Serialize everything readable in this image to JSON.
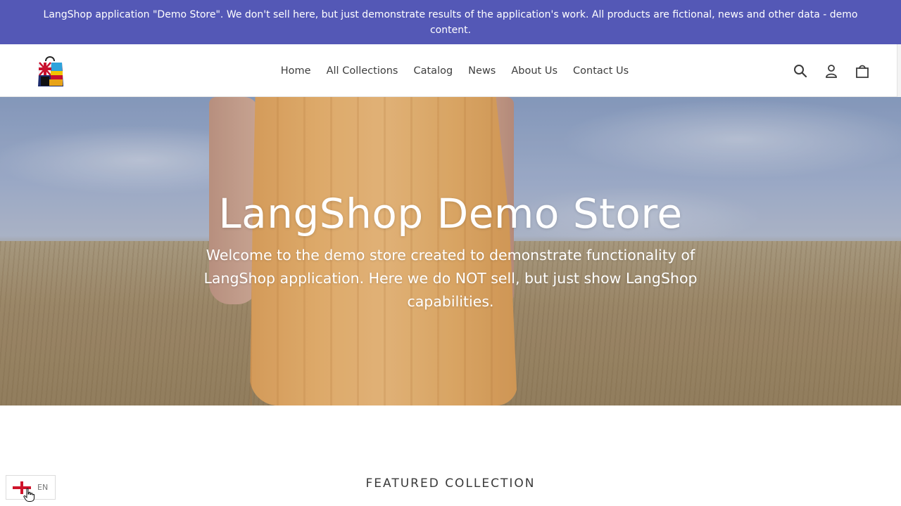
{
  "announcement": {
    "text": "LangShop application \"Demo Store\". We don't sell here, but just demonstrate results of the application's work. All products are fictional, news and other data - demo content."
  },
  "header": {
    "logo_icon": "shopping-bag-flags-logo",
    "nav": [
      {
        "label": "Home"
      },
      {
        "label": "All Collections"
      },
      {
        "label": "Catalog"
      },
      {
        "label": "News"
      },
      {
        "label": "About Us"
      },
      {
        "label": "Contact Us"
      }
    ],
    "icons": [
      "search-icon",
      "account-icon",
      "cart-icon"
    ]
  },
  "hero": {
    "title": "LangShop Demo Store",
    "subtitle": "Welcome to the demo store created to demonstrate functionality of LangShop application. Here we do NOT sell, but just show LangShop capabilities."
  },
  "featured": {
    "heading": "FEATURED COLLECTION"
  },
  "language_switcher": {
    "code": "EN",
    "flag_icon": "england-flag-icon"
  },
  "colors": {
    "announcement_bg": "#5458b6",
    "dress": "#f4b96e",
    "text": "#3a3a3a"
  }
}
